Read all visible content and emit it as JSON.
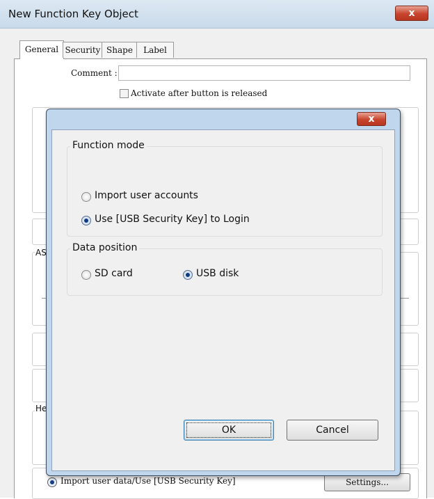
{
  "outer_window": {
    "title": "New Function Key Object",
    "close_glyph": "x",
    "tabs": [
      "General",
      "Security",
      "Shape",
      "Label"
    ],
    "comment_label": "Comment :",
    "comment_value": "",
    "activate_label": "Activate after button is released",
    "activate_checked": false,
    "partial_labels": [
      "AS",
      "He"
    ],
    "bottom_option_label": "Import user data/Use [USB Security Key]",
    "bottom_option_selected": true,
    "settings_label": "Settings..."
  },
  "dialog": {
    "close_glyph": "x",
    "function_mode": {
      "legend": "Function mode",
      "options": [
        {
          "label": "Import user accounts",
          "selected": false
        },
        {
          "label": "Use [USB Security Key] to Login",
          "selected": true
        }
      ]
    },
    "data_position": {
      "legend": "Data position",
      "options": [
        {
          "label": "SD card",
          "selected": false
        },
        {
          "label": "USB disk",
          "selected": true
        }
      ]
    },
    "ok_label": "OK",
    "cancel_label": "Cancel"
  },
  "colors": {
    "close_button": "#c7442d",
    "titlebar": "#c9daea",
    "dialog_frame": "#c0d6ed",
    "radio_dot": "#0c3a82"
  }
}
